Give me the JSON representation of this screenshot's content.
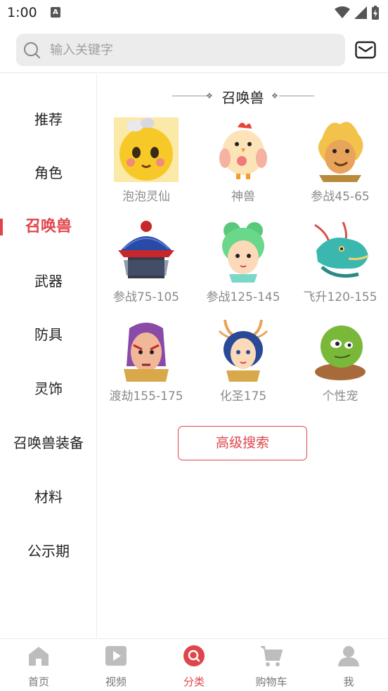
{
  "status": {
    "time": "1:00",
    "notification_glyph": "A"
  },
  "search": {
    "placeholder": "输入关键字"
  },
  "sidebar": {
    "items": [
      {
        "label": "推荐"
      },
      {
        "label": "角色"
      },
      {
        "label": "召唤兽",
        "active": true
      },
      {
        "label": "武器"
      },
      {
        "label": "防具"
      },
      {
        "label": "灵饰"
      },
      {
        "label": "召唤兽装备"
      },
      {
        "label": "材料"
      },
      {
        "label": "公示期"
      }
    ]
  },
  "section": {
    "title": "召唤兽",
    "items": [
      {
        "label": "泡泡灵仙",
        "icon": "bubble-spirit-icon"
      },
      {
        "label": "神兽",
        "icon": "chicken-beast-icon"
      },
      {
        "label": "参战45-65",
        "icon": "golden-monkey-icon"
      },
      {
        "label": "参战75-105",
        "icon": "hat-warrior-icon"
      },
      {
        "label": "参战125-145",
        "icon": "green-hair-girl-icon"
      },
      {
        "label": "飞升120-155",
        "icon": "dragon-icon"
      },
      {
        "label": "渡劫155-175",
        "icon": "masked-warrior-icon"
      },
      {
        "label": "化圣175",
        "icon": "horned-girl-icon"
      },
      {
        "label": "个性宠",
        "icon": "turtle-icon"
      }
    ],
    "advanced_search": "高级搜索"
  },
  "bottom_nav": {
    "items": [
      {
        "label": "首页",
        "icon": "home-icon"
      },
      {
        "label": "视频",
        "icon": "video-play-icon"
      },
      {
        "label": "分类",
        "icon": "category-search-icon",
        "active": true
      },
      {
        "label": "购物车",
        "icon": "shopping-cart-icon"
      },
      {
        "label": "我",
        "icon": "user-profile-icon"
      }
    ]
  },
  "colors": {
    "accent": "#e0454b",
    "text_primary": "#222222",
    "text_secondary": "#8a8a8a",
    "search_bg": "#ececec"
  }
}
